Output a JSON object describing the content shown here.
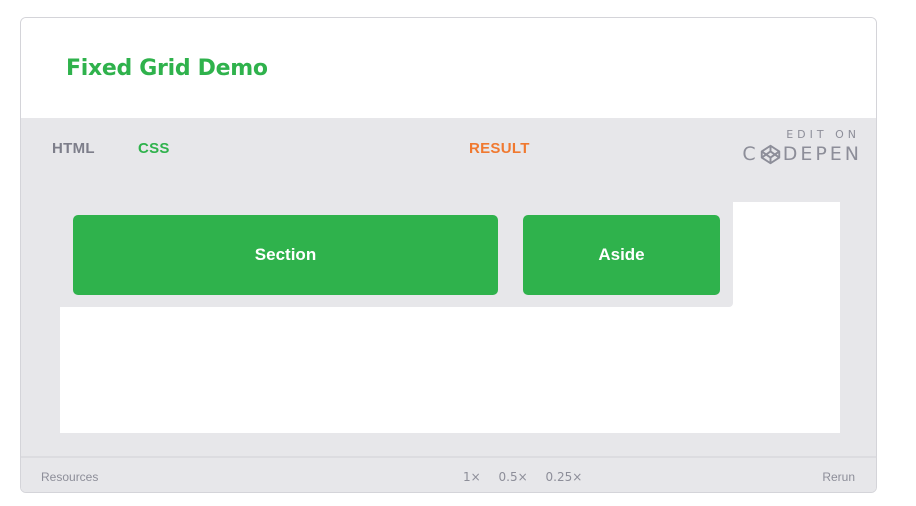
{
  "title": "Fixed Grid Demo",
  "tabs": {
    "html": "HTML",
    "css": "CSS",
    "result": "RESULT"
  },
  "edit_on": {
    "label": "EDIT ON",
    "brand_left": "C",
    "brand_right": "DEPEN"
  },
  "result": {
    "section": "Section",
    "aside": "Aside"
  },
  "footer": {
    "resources": "Resources",
    "zoom_levels": [
      "1×",
      "0.5×",
      "0.25×"
    ],
    "rerun": "Rerun"
  },
  "colors": {
    "brand_green": "#2fb24c",
    "result_orange": "#f07930",
    "muted_gray": "#8d8e99",
    "panel_bg": "#e7e7ea"
  }
}
